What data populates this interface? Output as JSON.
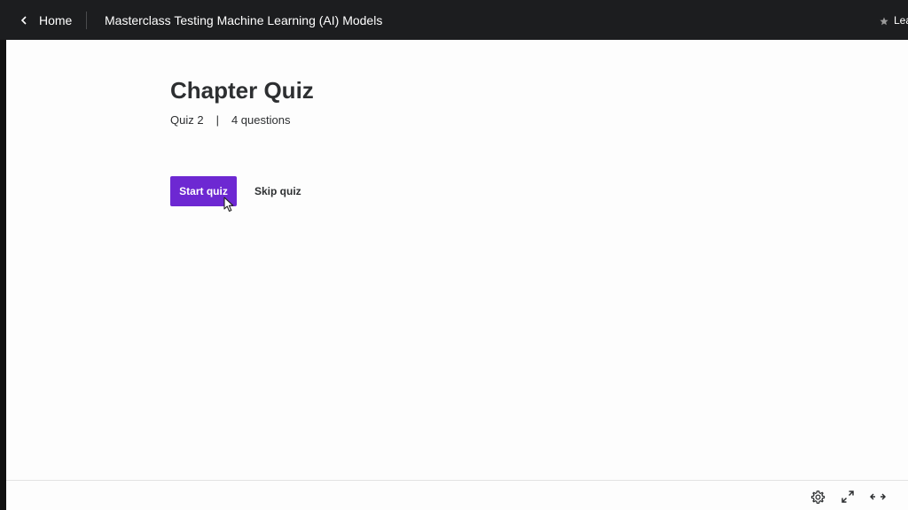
{
  "header": {
    "home_label": "Home",
    "course_title": "Masterclass Testing Machine Learning (AI) Models",
    "rating_label": "Leave a rating"
  },
  "quiz": {
    "title": "Chapter Quiz",
    "number_label": "Quiz 2",
    "separator": "|",
    "questions_label": "4 questions",
    "start_label": "Start quiz",
    "skip_label": "Skip quiz"
  },
  "controls": {
    "icons": [
      "gear-icon",
      "expand-icon",
      "widen-icon"
    ]
  },
  "colors": {
    "header_bg": "#1c1d1f",
    "accent": "#6d28d2",
    "text": "#2d2f31"
  }
}
